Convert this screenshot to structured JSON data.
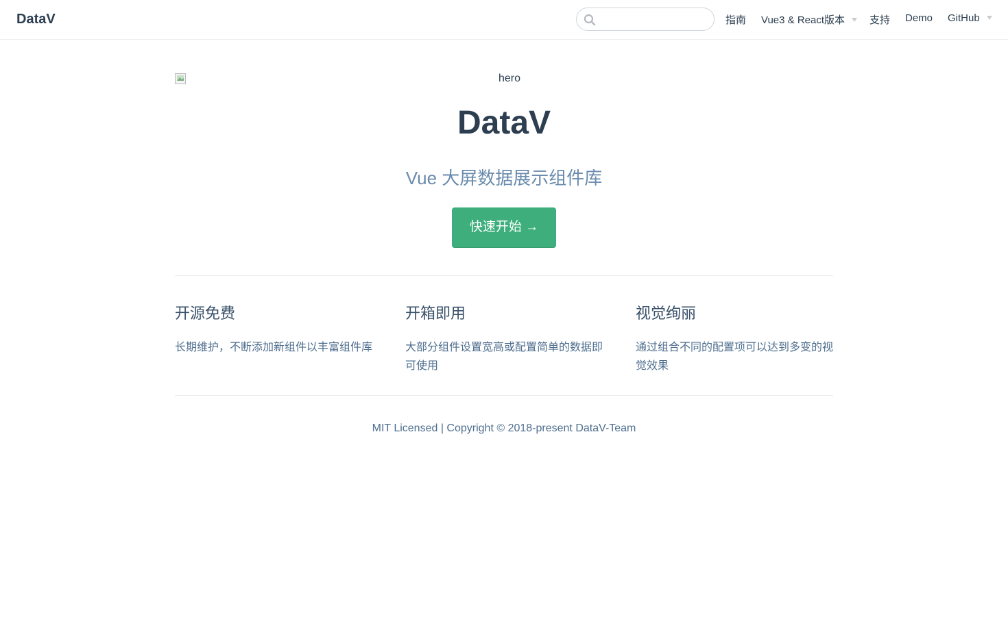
{
  "navbar": {
    "site_name": "DataV",
    "search": {
      "value": "",
      "placeholder": ""
    },
    "links": [
      {
        "label": "指南"
      },
      {
        "label": "Vue3 & React版本"
      },
      {
        "label": "支持"
      },
      {
        "label": "Demo"
      },
      {
        "label": "GitHub"
      }
    ]
  },
  "hero": {
    "image_alt": "hero",
    "title": "DataV",
    "description": "Vue 大屏数据展示组件库",
    "action_label": "快速开始 →"
  },
  "features": [
    {
      "title": "开源免费",
      "details": "长期维护，不断添加新组件以丰富组件库"
    },
    {
      "title": "开箱即用",
      "details": "大部分组件设置宽高或配置简单的数据即可使用"
    },
    {
      "title": "视觉绚丽",
      "details": "通过组合不同的配置项可以达到多变的视觉效果"
    }
  ],
  "footer": {
    "text": "MIT Licensed | Copyright © 2018-present DataV-Team"
  },
  "colors": {
    "accent": "#3eaf7c",
    "text": "#2c3e50",
    "muted": "#6a8bad"
  }
}
